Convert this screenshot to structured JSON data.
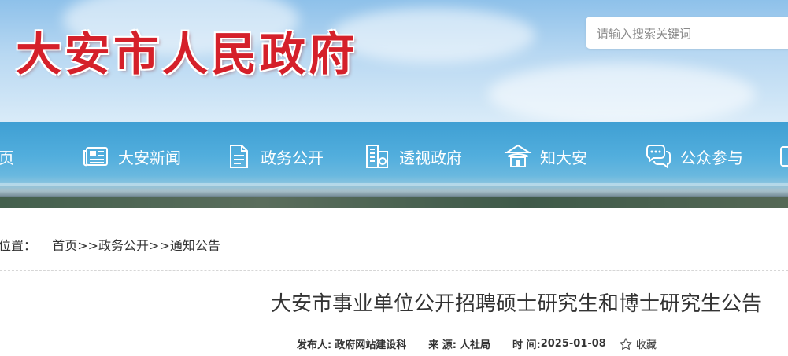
{
  "header": {
    "site_title": "大安市人民政府",
    "search": {
      "placeholder": "请输入搜索关键词",
      "value": ""
    }
  },
  "nav": {
    "items": [
      {
        "label": "页",
        "icon": ""
      },
      {
        "label": "大安新闻",
        "icon": "newspaper-icon"
      },
      {
        "label": "政务公开",
        "icon": "document-icon"
      },
      {
        "label": "透视政府",
        "icon": "building-icon"
      },
      {
        "label": "知大安",
        "icon": "pavilion-icon"
      },
      {
        "label": "公众参与",
        "icon": "chat-bubbles-icon"
      }
    ]
  },
  "breadcrumb": {
    "prefix": "位置：",
    "items": [
      "首页",
      "政务公开",
      "通知公告"
    ],
    "separator": ">>"
  },
  "article": {
    "title": "大安市事业单位公开招聘硕士研究生和博士研究生公告",
    "meta": {
      "publisher_label": "发布人:",
      "publisher": "政府网站建设科",
      "source_label": "来 源:",
      "source": "人社局",
      "time_label": "时 间:",
      "time": "2025-01-08",
      "favorite_label": "收藏"
    }
  },
  "colors": {
    "title_red": "#d5202a",
    "nav_blue": "#3f9fd3",
    "text": "#333333"
  }
}
